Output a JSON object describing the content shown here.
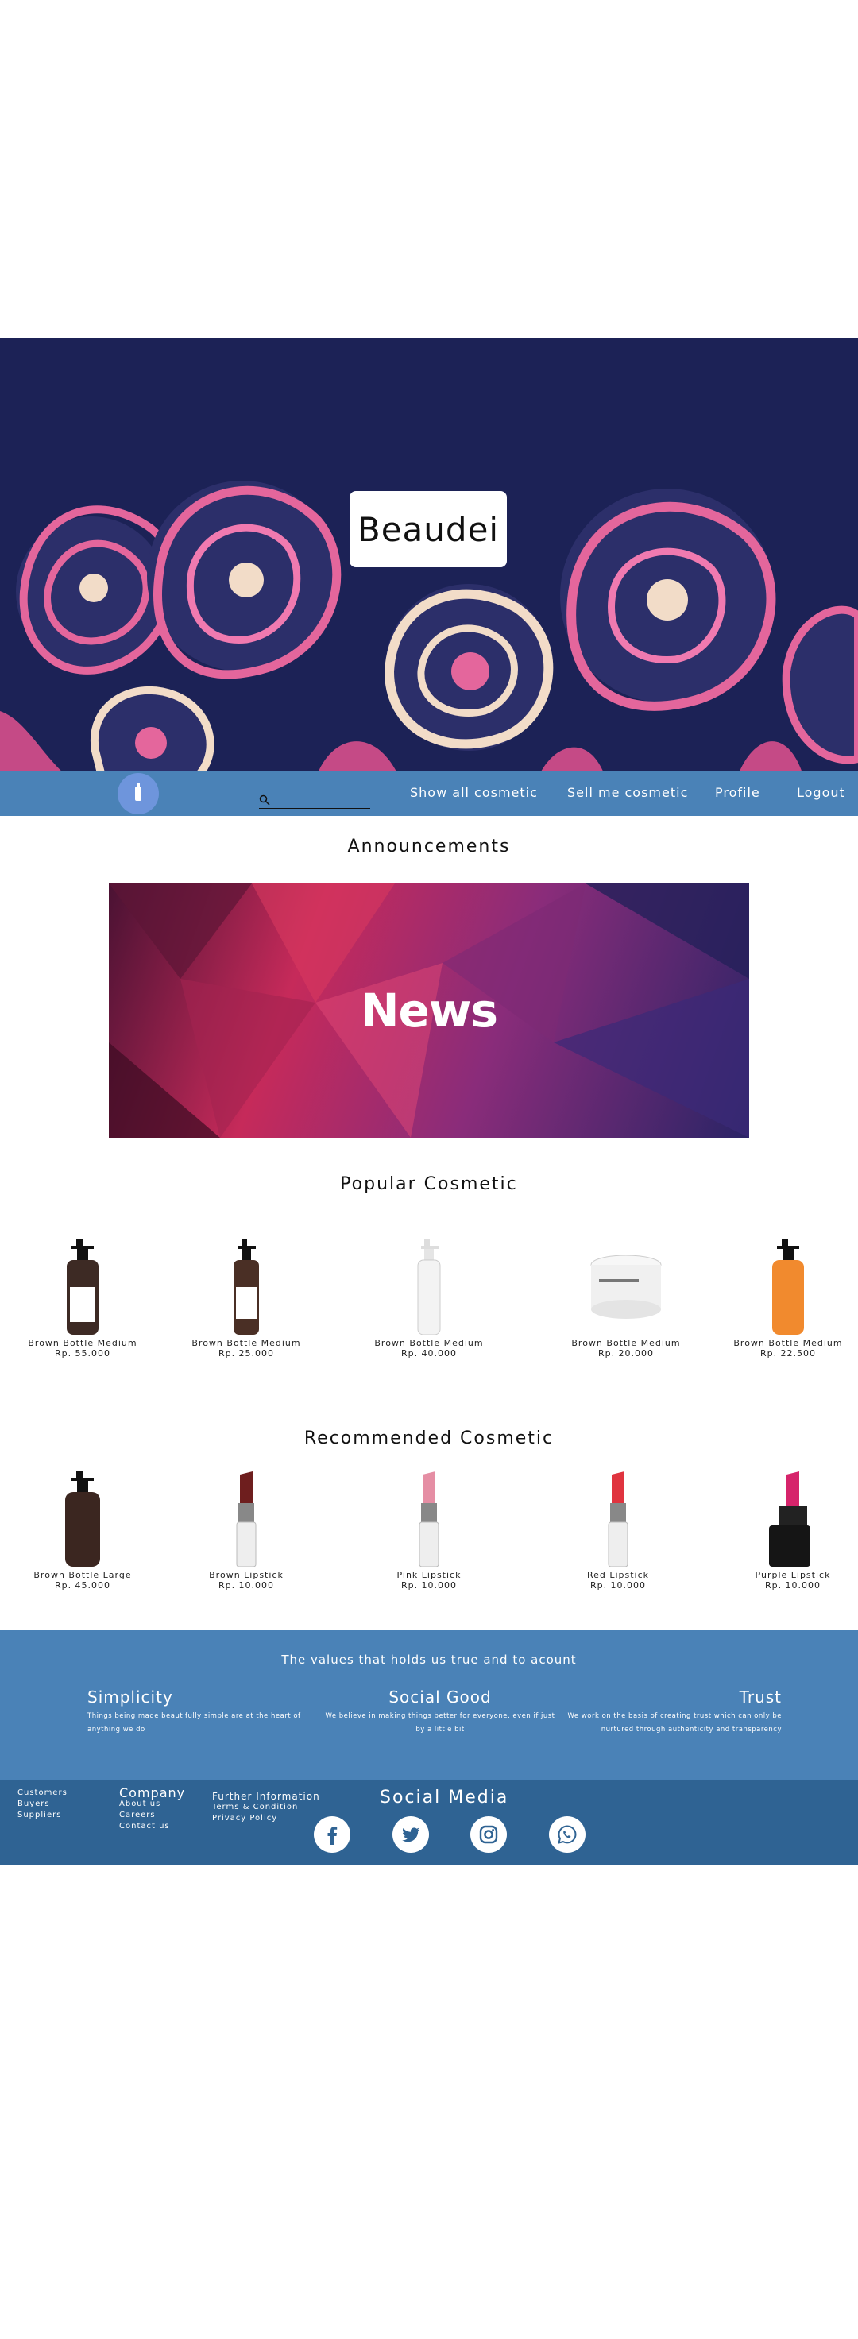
{
  "brand": {
    "name": "Beaudei"
  },
  "nav": {
    "links": [
      {
        "label": "Show all cosmetic"
      },
      {
        "label": "Sell me cosmetic"
      },
      {
        "label": "Profile"
      },
      {
        "label": "Logout"
      }
    ],
    "search_placeholder": ""
  },
  "announcements": {
    "title": "Announcements",
    "banner_text": "News"
  },
  "popular": {
    "title": "Popular Cosmetic",
    "items": [
      {
        "name": "Brown Bottle Medium",
        "price": "Rp. 55.000",
        "icon": "brown-pump-bottle"
      },
      {
        "name": "Brown Bottle Medium",
        "price": "Rp. 25.000",
        "icon": "brown-pump-bottle"
      },
      {
        "name": "Brown Bottle Medium",
        "price": "Rp. 40.000",
        "icon": "white-pump-bottle"
      },
      {
        "name": "Brown Bottle Medium",
        "price": "Rp. 20.000",
        "icon": "white-cream-jar"
      },
      {
        "name": "Brown Bottle Medium",
        "price": "Rp. 22.500",
        "icon": "orange-pump-bottle"
      }
    ]
  },
  "recommended": {
    "title": "Recommended Cosmetic",
    "items": [
      {
        "name": "Brown Bottle Large",
        "price": "Rp. 45.000",
        "icon": "dark-pump-bottle"
      },
      {
        "name": "Brown Lipstick",
        "price": "Rp. 10.000",
        "icon": "lipstick-brown"
      },
      {
        "name": "Pink Lipstick",
        "price": "Rp. 10.000",
        "icon": "lipstick-pink"
      },
      {
        "name": "Red Lipstick",
        "price": "Rp. 10.000",
        "icon": "lipstick-red"
      },
      {
        "name": "Purple Lipstick",
        "price": "Rp. 10.000",
        "icon": "lipstick-purple"
      }
    ]
  },
  "values": {
    "title": "The values that holds us true and to acount",
    "items": [
      {
        "heading": "Simplicity",
        "text": "Things being made beautifully simple are at the heart of anything we do"
      },
      {
        "heading": "Social Good",
        "text": "We believe in making things better for everyone, even if just by a little bit"
      },
      {
        "heading": "Trust",
        "text": "We work on the basis of creating trust which can only be nurtured through authenticity and transparency"
      }
    ]
  },
  "footer": {
    "audience": [
      "Customers",
      "Buyers",
      "Suppliers"
    ],
    "company": {
      "heading": "Company",
      "links": [
        "About us",
        "Careers",
        "Contact us"
      ]
    },
    "further": {
      "heading": "Further Information",
      "links": [
        "Terms & Condition",
        "Privacy Policy"
      ]
    },
    "social": {
      "heading": "Social Media",
      "icons": [
        "facebook-icon",
        "twitter-icon",
        "instagram-icon",
        "whatsapp-icon"
      ]
    }
  },
  "colors": {
    "hero_bg": "#1c2256",
    "nav_bg": "#4a82b7",
    "footer_bg": "#2f6393",
    "flower_pink": "#e4669c",
    "flower_cream": "#f2dcc8"
  }
}
